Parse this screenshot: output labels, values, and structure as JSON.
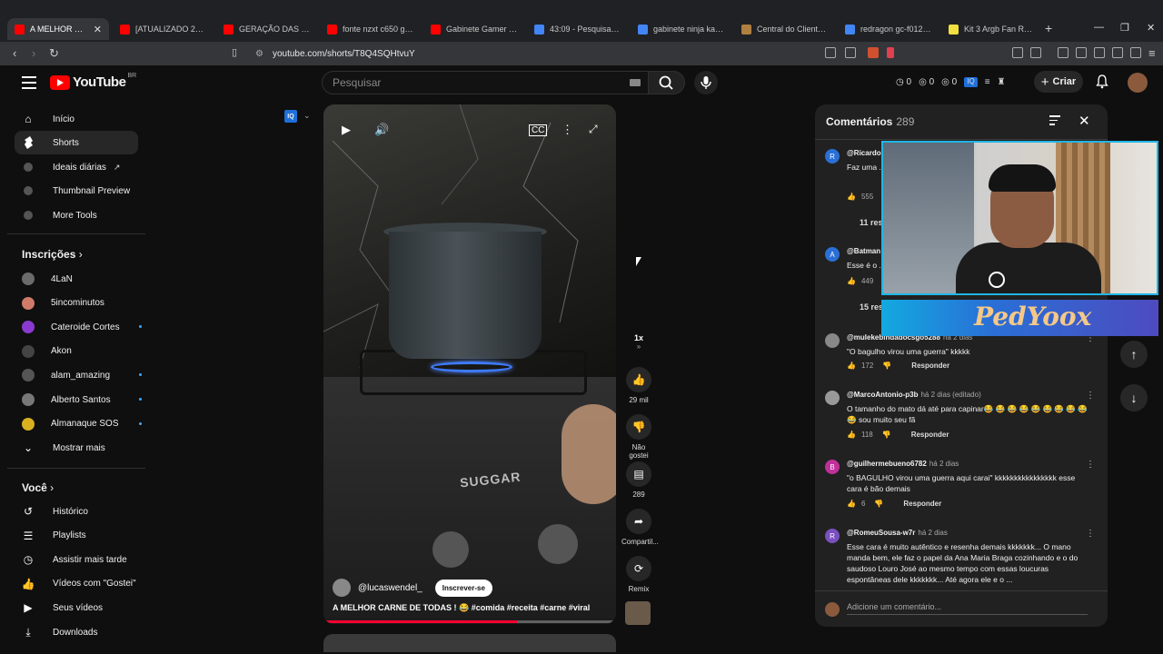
{
  "browser": {
    "tabs": [
      {
        "title": "A MELHOR CA...",
        "active": true,
        "color": "#ff0000"
      },
      {
        "title": "[ATUALIZADO 2026] C...",
        "color": "#ff0000"
      },
      {
        "title": "GERAÇÃO DAS PLACA...",
        "color": "#ff0000"
      },
      {
        "title": "fonte nzxt c650 gold -...",
        "color": "#ff0000"
      },
      {
        "title": "Gabinete Gamer Ninja ...",
        "color": "#ff0000"
      },
      {
        "title": "43:09 - Pesquisa Goog...",
        "color": "#4285f4"
      },
      {
        "title": "gabinete ninja kazan x...",
        "color": "#4285f4"
      },
      {
        "title": "Central do Cliente : TE...",
        "color": "#b08040"
      },
      {
        "title": "redragon gc-f012 - Pe...",
        "color": "#4285f4"
      },
      {
        "title": "Kit 3 Argb Fan Redrag...",
        "color": "#f0e040"
      }
    ],
    "url": "youtube.com/shorts/T8Q4SQHtvuY"
  },
  "header": {
    "logo_text": "YouTube",
    "region": "BR",
    "search_placeholder": "Pesquisar",
    "stats": [
      "0",
      "0",
      "0"
    ],
    "create_label": "Criar"
  },
  "sidebar": {
    "main": [
      {
        "label": "Início",
        "icon": "home-icon"
      },
      {
        "label": "Shorts",
        "icon": "shorts-icon",
        "active": true
      },
      {
        "label": "Ideais diárias",
        "icon": "extension-icon",
        "external": true
      },
      {
        "label": "Thumbnail Preview",
        "icon": "extension-icon"
      },
      {
        "label": "More Tools",
        "icon": "extension-icon"
      }
    ],
    "subscriptions_heading": "Inscrições",
    "subscriptions": [
      {
        "label": "4LaN",
        "color": "#6b6b6b",
        "dot": false
      },
      {
        "label": "5incominutos",
        "color": "#d07a6a",
        "dot": false
      },
      {
        "label": "Cateroide Cortes",
        "color": "#8a3ad0",
        "dot": true
      },
      {
        "label": "Akon",
        "color": "#444444",
        "dot": false
      },
      {
        "label": "alam_amazing",
        "color": "#555555",
        "dot": true
      },
      {
        "label": "Alberto Santos",
        "color": "#777777",
        "dot": true
      },
      {
        "label": "Almanaque SOS",
        "color": "#d8b020",
        "dot": true
      }
    ],
    "show_more": "Mostrar mais",
    "you_heading": "Você",
    "you": [
      {
        "label": "Histórico",
        "icon": "history-icon"
      },
      {
        "label": "Playlists",
        "icon": "playlist-icon"
      },
      {
        "label": "Assistir mais tarde",
        "icon": "clock-icon"
      },
      {
        "label": "Vídeos com \"Gostei\"",
        "icon": "thumbs-up-icon"
      },
      {
        "label": "Seus vídeos",
        "icon": "video-icon"
      },
      {
        "label": "Downloads",
        "icon": "download-icon"
      }
    ]
  },
  "short": {
    "channel": "@lucaswendel_",
    "subscribe_label": "Inscrever-se",
    "title": "A MELHOR CARNE DE TODAS ! 😂 #comida #receita #carne #viral",
    "brand_on_stove": "SUGGAR",
    "progress_fraction": 0.66
  },
  "actions": {
    "speed": "1x",
    "likes": "29 mil",
    "dislike_label": "Não gostei",
    "comments": "289",
    "share_label": "Compartil...",
    "remix_label": "Remix"
  },
  "comments": {
    "title": "Comentários",
    "count": "289",
    "items": [
      {
        "avatar": "R",
        "color": "#2a6fd6",
        "user": "@Ricardo",
        "time": "",
        "text": "Faz uma ... ❤️",
        "likes": "555",
        "replies": "11 respostas"
      },
      {
        "avatar": "A",
        "color": "#2a6fd6",
        "user": "@Batman",
        "time": "",
        "text": "Esse é o ...",
        "likes": "449",
        "replies": "15 respostas"
      },
      {
        "avatar": "",
        "color": "#888888",
        "user": "@mulekebindadocsgo5288",
        "time": "há 2 dias",
        "text": "\"O bagulho virou uma guerra\" kkkkk",
        "likes": "172",
        "reply": "Responder"
      },
      {
        "avatar": "",
        "color": "#999999",
        "user": "@MarcoAntonio-p3b",
        "time": "há 2 dias (editado)",
        "text": "O tamanho do mato dá até para capinar😂 😂 😂 😂 😂 😂 😂 😂 😂 😂 sou muito seu fã",
        "likes": "118",
        "reply": "Responder"
      },
      {
        "avatar": "B",
        "color": "#c0309a",
        "user": "@guilhermebueno6782",
        "time": "há 2 dias",
        "text": "\"o BAGULHO virou uma guerra aqui carai\" kkkkkkkkkkkkkkkk esse cara é bão demais",
        "likes": "6",
        "reply": "Responder"
      },
      {
        "avatar": "R",
        "color": "#7a50c0",
        "user": "@RomeuSousa-w7r",
        "time": "há 2 dias",
        "text": "Esse cara é muito autêntico e resenha demais kkkkkkk... O mano manda bem, ele faz o papel da Ana Maria Braga cozinhando e o do saudoso Louro José ao mesmo tempo com essas loucuras espontâneas dele kkkkkkk... Até agora ele e o ...",
        "likes": "",
        "reply": ""
      }
    ],
    "add_placeholder": "Adicione um comentário..."
  },
  "overlay": {
    "banner_text": "PedYoox"
  }
}
